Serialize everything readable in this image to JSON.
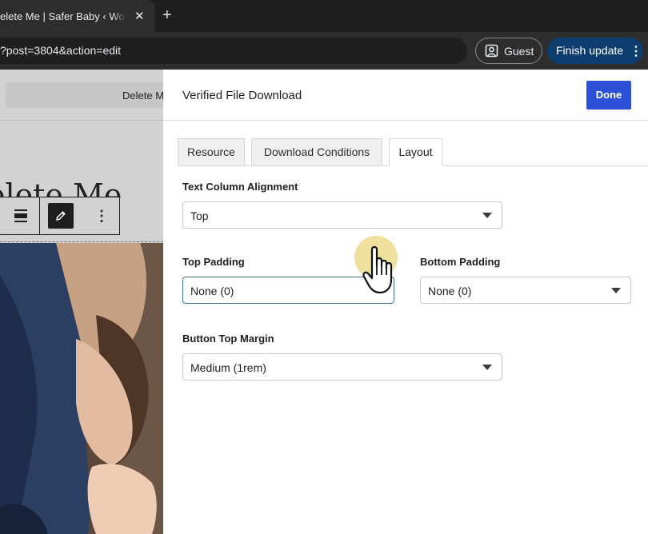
{
  "browser": {
    "tab_title": "elete Me | Safer Baby ‹ Work",
    "tab_close": "✕",
    "new_tab": "+",
    "url": "?post=3804&action=edit",
    "guest_label": "Guest",
    "finish_label": "Finish update",
    "finish_menu": "⋮"
  },
  "editor": {
    "title_field": "Delete M",
    "heading": "elete Me",
    "more_options": "⋮"
  },
  "panel": {
    "title": "Verified File Download",
    "done_label": "Done",
    "tabs": [
      {
        "label": "Resource",
        "active": false
      },
      {
        "label": "Download Conditions",
        "active": false
      },
      {
        "label": "Layout",
        "active": true
      }
    ],
    "fields": {
      "text_column_alignment": {
        "label": "Text Column Alignment",
        "value": "Top"
      },
      "top_padding": {
        "label": "Top Padding",
        "value": "None (0)"
      },
      "bottom_padding": {
        "label": "Bottom Padding",
        "value": "None (0)"
      },
      "button_top_margin": {
        "label": "Button Top Margin",
        "value": "Medium (1rem)"
      }
    }
  },
  "colors": {
    "done_button": "#2c50d8",
    "finish_button": "#0d3d6e",
    "cursor_highlight": "#ecda8c"
  },
  "icons": [
    "guest-profile-icon",
    "align-icon",
    "pencil-icon",
    "hand-pointer-icon",
    "chevron-down-icon"
  ]
}
